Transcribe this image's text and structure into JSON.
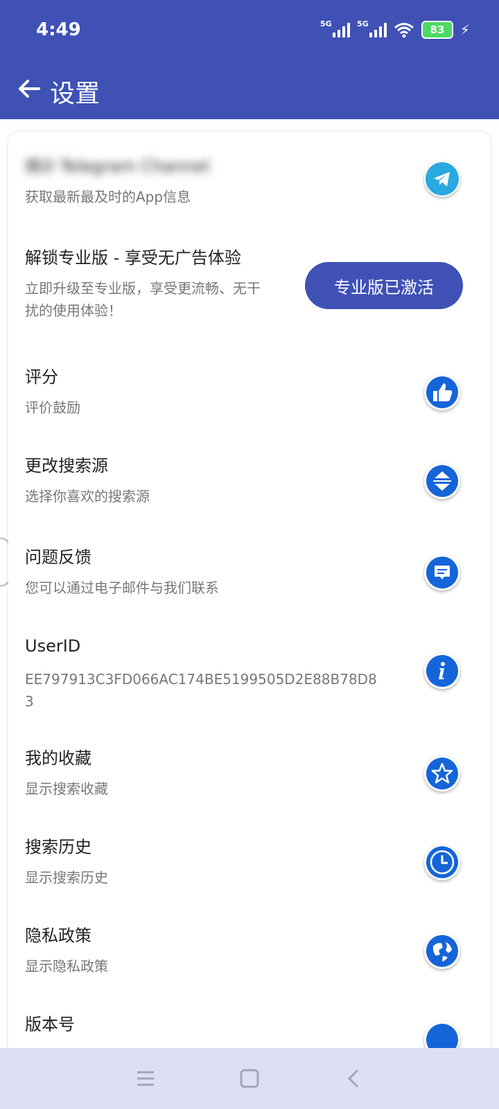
{
  "status": {
    "time": "4:49",
    "sim1": "5G",
    "sim2": "5G",
    "battery": "83"
  },
  "header": {
    "title": "设置"
  },
  "settings": {
    "telegram": {
      "title": "炼D Telegram Channel",
      "subtitle": "获取最新最及时的App信息",
      "icon": "telegram-icon"
    },
    "pro": {
      "title": "解锁专业版 - 享受无广告体验",
      "subtitle": "立即升级至专业版，享受更流畅、无干扰的使用体验！",
      "button": "专业版已激活"
    },
    "rate": {
      "title": "评分",
      "subtitle": "评价鼓励",
      "icon": "thumbs-up-icon"
    },
    "source": {
      "title": "更改搜索源",
      "subtitle": "选择你喜欢的搜索源",
      "icon": "sort-icon"
    },
    "feedback": {
      "title": "问题反馈",
      "subtitle": "您可以通过电子邮件与我们联系",
      "icon": "message-icon"
    },
    "userid": {
      "title": "UserID",
      "subtitle": "EE797913C3FD066AC174BE5199505D2E88B78D83",
      "icon": "info-icon"
    },
    "favorites": {
      "title": "我的收藏",
      "subtitle": "显示搜索收藏",
      "icon": "star-icon"
    },
    "history": {
      "title": "搜索历史",
      "subtitle": "显示搜索历史",
      "icon": "clock-icon"
    },
    "privacy": {
      "title": "隐私政策",
      "subtitle": "显示隐私政策",
      "icon": "globe-icon"
    },
    "version": {
      "title": "版本号"
    }
  },
  "colors": {
    "primary": "#3f51b5",
    "icon_blue": "#1565d8",
    "telegram": "#2aa8e0"
  }
}
